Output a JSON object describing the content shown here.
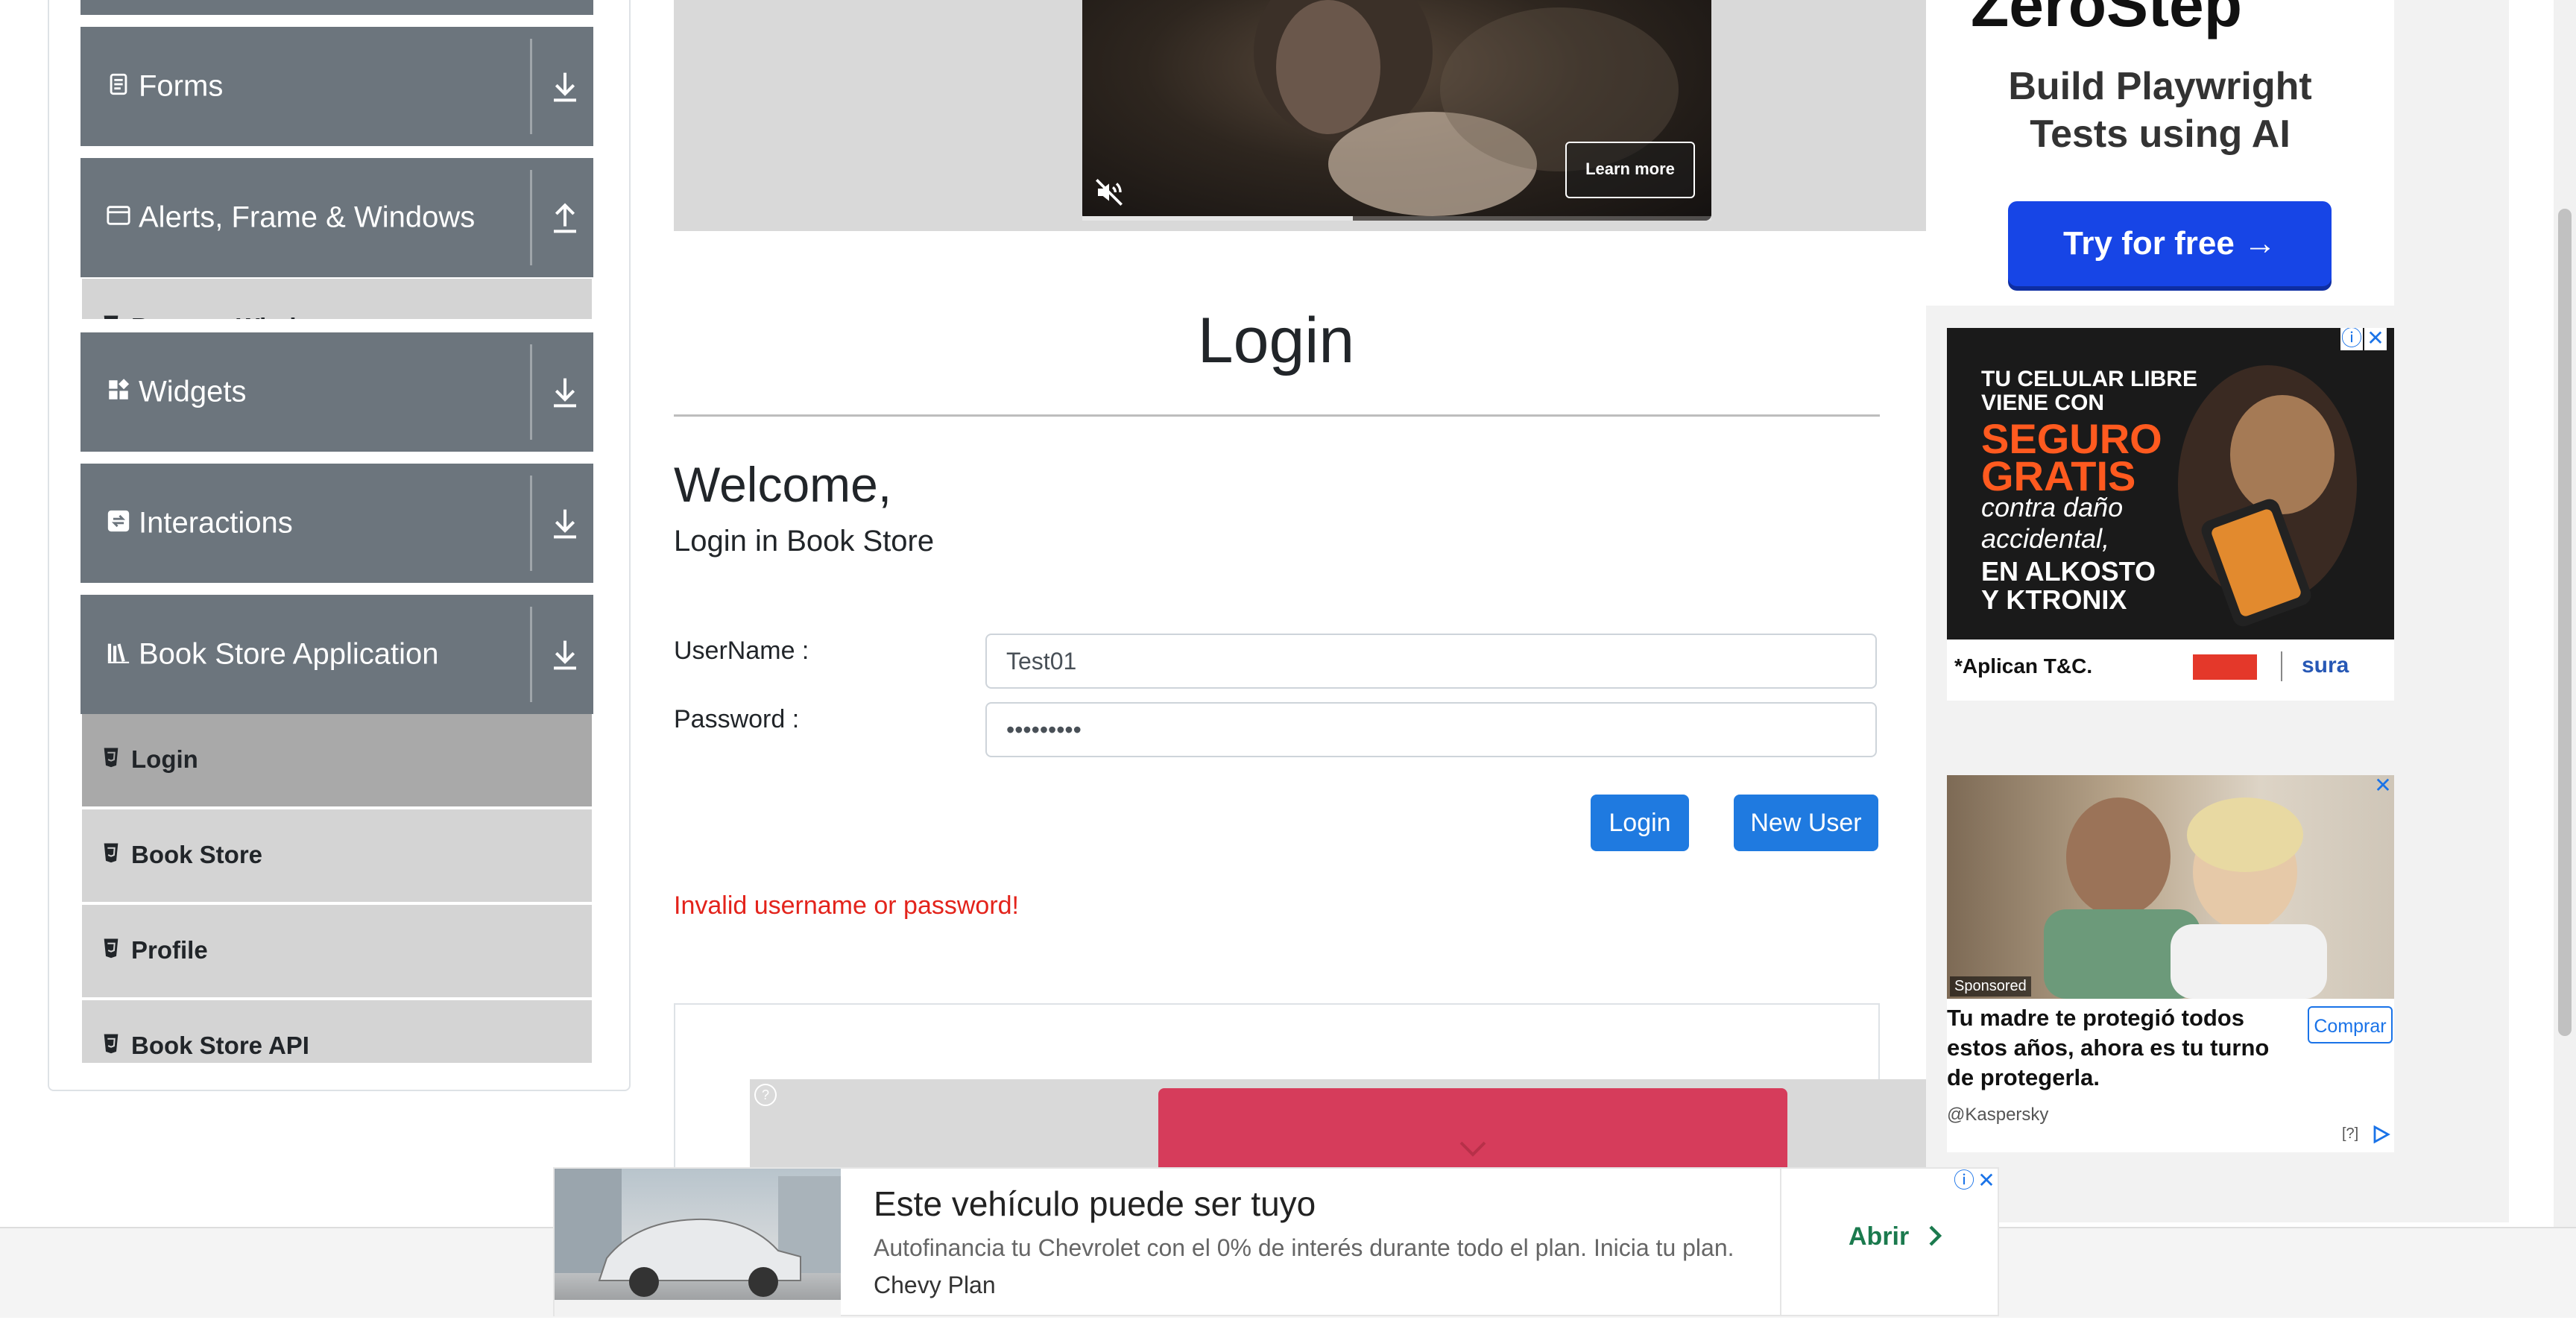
{
  "sidebar": {
    "groups": [
      {
        "label": "Forms",
        "icon": "form-icon",
        "arrow": "download-arrow-icon"
      },
      {
        "label": "Alerts, Frame & Windows",
        "icon": "window-icon",
        "arrow": "upload-arrow-icon"
      },
      {
        "label": "Widgets",
        "icon": "widgets-icon",
        "arrow": "download-arrow-icon"
      },
      {
        "label": "Interactions",
        "icon": "interactions-icon",
        "arrow": "download-arrow-icon"
      },
      {
        "label": "Book Store Application",
        "icon": "books-icon",
        "arrow": "download-arrow-icon"
      }
    ],
    "alerts_subitem_partial": "Browser Windows",
    "book_store_items": [
      {
        "label": "Login",
        "active": true
      },
      {
        "label": "Book Store",
        "active": false
      },
      {
        "label": "Profile",
        "active": false
      },
      {
        "label": "Book Store API",
        "active": false
      }
    ]
  },
  "video": {
    "learn_more": "Learn more",
    "mute_icon": "muted-speaker-icon",
    "progress": 0.43
  },
  "main": {
    "title": "Login",
    "welcome": "Welcome,",
    "subtitle": "Login in Book Store",
    "username_label": "UserName :",
    "username_value": "Test01",
    "password_label": "Password :",
    "password_value": "•••••••••",
    "login_button": "Login",
    "new_user_button": "New User",
    "error": "Invalid username or password!"
  },
  "ads": {
    "playwright": {
      "brand_partial": "ZeroStep",
      "headline_1": "Build Playwright",
      "headline_2": "Tests using AI",
      "cta": "Try for free →"
    },
    "alkosto": {
      "line1": "TU CELULAR LIBRE",
      "line2": "VIENE CON",
      "line3": "SEGURO",
      "line4": "GRATIS",
      "line5": "contra daño",
      "line6": "accidental,",
      "line7": "EN ALKOSTO",
      "line8": "Y KTRONIX",
      "footer": "*Aplican T&C.",
      "brand": "sura"
    },
    "kaspersky": {
      "sponsored": "Sponsored",
      "title": "Tu madre te protegió todos estos años, ahora es tu turno de protegerla.",
      "cta": "Comprar",
      "source": "@Kaspersky",
      "help": "[?]"
    },
    "chevrolet": {
      "title": "Este vehículo puede ser tuyo",
      "description": "Autofinancia tu Chevrolet con el 0% de interés durante todo el plan. Inicia tu plan.",
      "brand": "Chevy Plan",
      "cta": "Abrir"
    }
  },
  "colors": {
    "sidebar_header": "#6c757d",
    "menu_item": "#d4d4d4",
    "menu_item_active": "#a9a9a9",
    "primary_button": "#1f7ae0",
    "error_text": "#e3231b",
    "ad_cta_blue": "#1745e6"
  }
}
